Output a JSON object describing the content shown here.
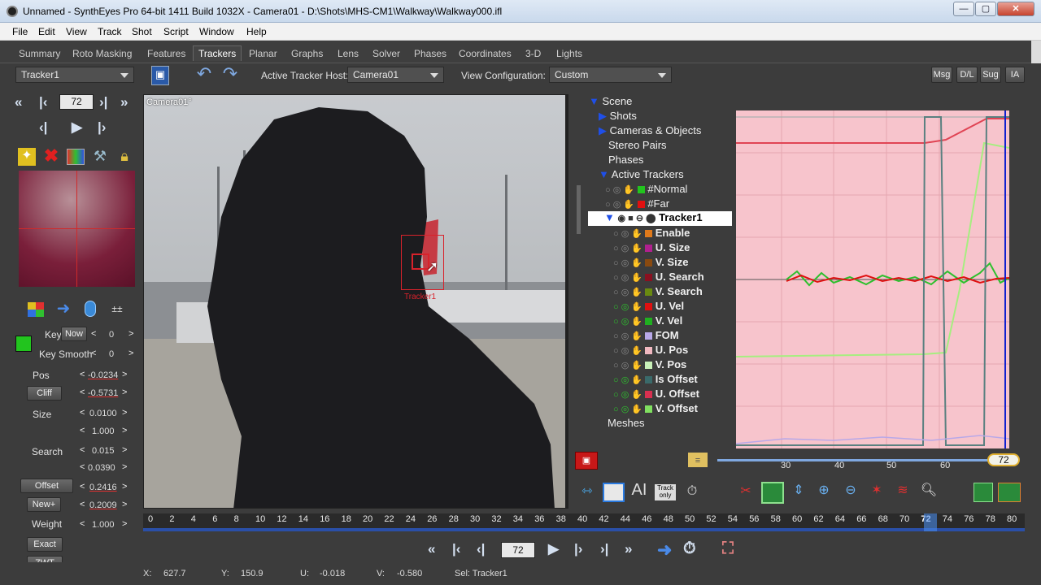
{
  "window": {
    "title": "Unnamed - SynthEyes Pro 64-bit 1411 Build 1032X - Camera01 - D:\\Shots\\MHS-CM1\\Walkway\\Walkway000.ifl",
    "min": "—",
    "max": "▢",
    "close": "✕"
  },
  "menu": [
    "File",
    "Edit",
    "View",
    "Track",
    "Shot",
    "Script",
    "Window",
    "Help"
  ],
  "tabs": [
    "Summary",
    "Roto Masking",
    "Features",
    "Trackers",
    "Planar",
    "Graphs",
    "Lens",
    "Solver",
    "Phases",
    "Coordinates",
    "3-D",
    "Lights"
  ],
  "active_tab": "Trackers",
  "toolbar": {
    "tracker_select": "Tracker1",
    "active_host_label": "Active Tracker Host:",
    "active_host_value": "Camera01",
    "view_config_label": "View Configuration:",
    "view_config_value": "Custom",
    "right_buttons": [
      "Msg",
      "D/L",
      "Sug",
      "IA"
    ]
  },
  "left": {
    "frame": "72",
    "key_label": "Key",
    "now_button": "Now",
    "key_value": "0",
    "key_smooth_label": "Key Smooth",
    "key_smooth_value": "0",
    "pos_label": "Pos",
    "pos_x": "-0.0234",
    "pos_y": "-0.5731",
    "cliff_button": "Cliff",
    "size_label": "Size",
    "size_x": "0.0100",
    "size_y": "1.000",
    "search_label": "Search",
    "search_x": "0.015",
    "search_y": "0.0390",
    "offset_button": "Offset",
    "offset_x": "0.2416",
    "new_button": "New+",
    "offset_y": "0.2009",
    "weight_label": "Weight",
    "weight_value": "1.000",
    "exact_button": "Exact",
    "zwt_button": "ZWT",
    "tracker_color": "#22c41e"
  },
  "viewport": {
    "label": "Camera01°",
    "tracker_label": "Tracker1",
    "tracker_color": "#d8222b"
  },
  "tree": {
    "scene": "Scene",
    "shots": "Shots",
    "cameras": "Cameras & Objects",
    "stereo": "Stereo Pairs",
    "phases": "Phases",
    "active_trackers": "Active Trackers",
    "normal": "#Normal",
    "far": "#Far",
    "tracker": "Tracker1",
    "channels": [
      {
        "name": "Enable",
        "color": "#e07a1b"
      },
      {
        "name": "U. Size",
        "color": "#b0208e"
      },
      {
        "name": "V. Size",
        "color": "#8a4a10"
      },
      {
        "name": "U. Search",
        "color": "#8a1020"
      },
      {
        "name": "V. Search",
        "color": "#6a8a10"
      },
      {
        "name": "U. Vel",
        "color": "#e01010"
      },
      {
        "name": "V. Vel",
        "color": "#20b020"
      },
      {
        "name": "FOM",
        "color": "#b8a8e8"
      },
      {
        "name": "U. Pos",
        "color": "#f0b8c0"
      },
      {
        "name": "V. Pos",
        "color": "#c8f0b8"
      },
      {
        "name": "Is Offset",
        "color": "#3a6a6a"
      },
      {
        "name": "U. Offset",
        "color": "#d83050"
      },
      {
        "name": "V. Offset",
        "color": "#80e060"
      }
    ],
    "meshes": "Meshes"
  },
  "graph": {
    "scale_ticks": [
      "30",
      "40",
      "50",
      "60"
    ],
    "current_frame": "72"
  },
  "timeline": {
    "ticks": [
      "0",
      "2",
      "4",
      "6",
      "8",
      "10",
      "12",
      "14",
      "16",
      "18",
      "20",
      "22",
      "24",
      "26",
      "28",
      "30",
      "32",
      "34",
      "36",
      "38",
      "40",
      "42",
      "44",
      "46",
      "48",
      "50",
      "52",
      "54",
      "56",
      "58",
      "60",
      "62",
      "64",
      "66",
      "68",
      "70",
      "72",
      "74",
      "76",
      "78",
      "80"
    ],
    "current": "72"
  },
  "playback": {
    "frame": "72"
  },
  "status": {
    "x_label": "X:",
    "x": "627.7",
    "y_label": "Y:",
    "y": "150.9",
    "u_label": "U:",
    "u": "-0.018",
    "v_label": "V:",
    "v": "-0.580",
    "sel": "Sel: Tracker1"
  }
}
